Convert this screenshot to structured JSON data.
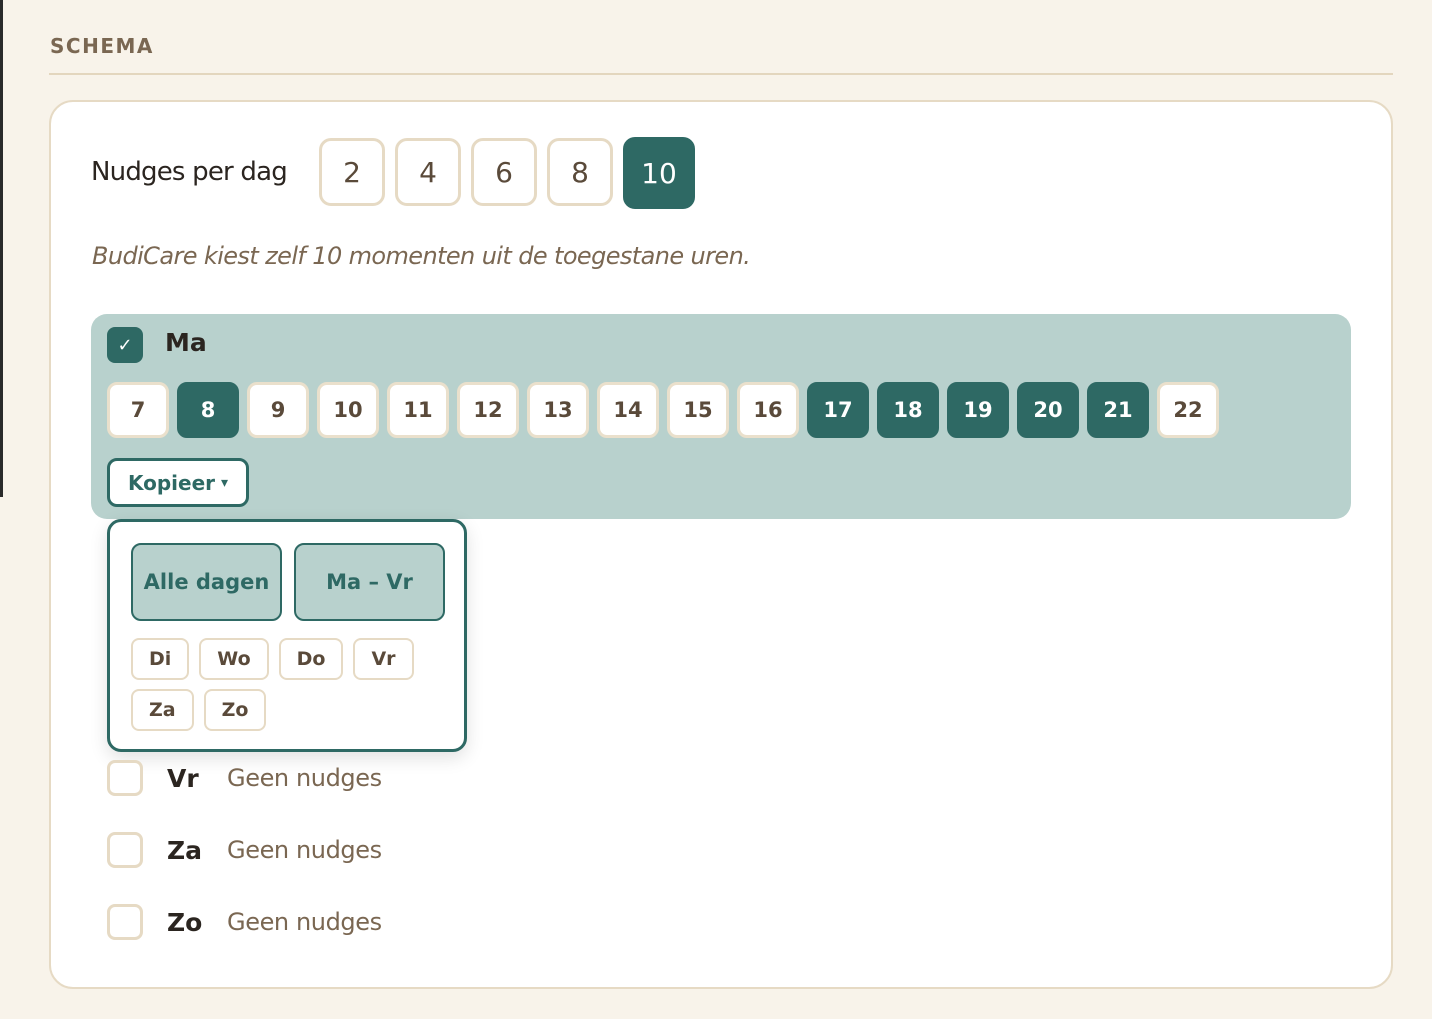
{
  "section": {
    "title": "SCHEMA"
  },
  "nudges_per_dag": {
    "label": "Nudges per dag",
    "options": [
      "2",
      "4",
      "6",
      "8",
      "10"
    ],
    "selected": "10"
  },
  "hint": "BudiCare kiest zelf 10 momenten uit de toegestane uren.",
  "active_day": {
    "name": "Ma",
    "checked": true,
    "hours": [
      {
        "label": "7",
        "on": false
      },
      {
        "label": "8",
        "on": true
      },
      {
        "label": "9",
        "on": false
      },
      {
        "label": "10",
        "on": false
      },
      {
        "label": "11",
        "on": false
      },
      {
        "label": "12",
        "on": false
      },
      {
        "label": "13",
        "on": false
      },
      {
        "label": "14",
        "on": false
      },
      {
        "label": "15",
        "on": false
      },
      {
        "label": "16",
        "on": false
      },
      {
        "label": "17",
        "on": true
      },
      {
        "label": "18",
        "on": true
      },
      {
        "label": "19",
        "on": true
      },
      {
        "label": "20",
        "on": true
      },
      {
        "label": "21",
        "on": true
      },
      {
        "label": "22",
        "on": false
      }
    ]
  },
  "copy": {
    "button_label": "Kopieer",
    "caret": "▾",
    "menu": {
      "all_days": "Alle dagen",
      "weekdays": "Ma – Vr",
      "days": [
        "Di",
        "Wo",
        "Do",
        "Vr",
        "Za",
        "Zo"
      ]
    }
  },
  "other_days": [
    {
      "name": "Vr",
      "status": "Geen nudges",
      "checked": false
    },
    {
      "name": "Za",
      "status": "Geen nudges",
      "checked": false
    },
    {
      "name": "Zo",
      "status": "Geen nudges",
      "checked": false
    }
  ],
  "colors": {
    "accent": "#2e6964",
    "active_day_bg": "#b8d1cd",
    "page_bg": "#f8f3ea",
    "border": "#e6dac4"
  },
  "icons": {
    "checkbox_checked": "check-icon",
    "dropdown": "chevron-down-icon"
  }
}
